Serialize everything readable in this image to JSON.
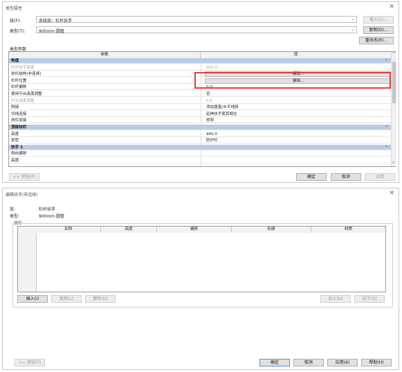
{
  "type_props": {
    "title": "类型属性",
    "family_label": "族(F):",
    "family_value": "系统族：栏杆扶手",
    "type_label": "类型(T):",
    "type_value": "900mm 圆管",
    "load_button": "载入(L)...",
    "duplicate_button": "复制(D)...",
    "rename_button": "重命名(R)...",
    "section_label": "类型参数",
    "col_param": "参数",
    "col_value": "值",
    "rows": [
      {
        "name": "构造",
        "value": "",
        "group": true
      },
      {
        "name": "栏杆扶手高度",
        "value": "900.0",
        "dim": true
      },
      {
        "name": "扶栏结构(非连续)",
        "value": "编辑...",
        "edit": true
      },
      {
        "name": "栏杆位置",
        "value": "编辑...",
        "edit": true
      },
      {
        "name": "栏杆偏移",
        "value": "0.0"
      },
      {
        "name": "使用平台高度调整",
        "value": "否"
      },
      {
        "name": "平台高度调整",
        "value": "0.0",
        "dim": true
      },
      {
        "name": "斜接",
        "value": "添加垂直/水平线段"
      },
      {
        "name": "切线连接",
        "value": "延伸扶手使其相交"
      },
      {
        "name": "扶栏连接",
        "value": "修剪"
      },
      {
        "name": "顶部扶栏",
        "value": "",
        "group": true
      },
      {
        "name": "高度",
        "value": "900.0"
      },
      {
        "name": "类型",
        "value": "防护栏"
      },
      {
        "name": "扶手 1",
        "value": "",
        "group": true
      },
      {
        "name": "侧向偏移",
        "value": ""
      },
      {
        "name": "高度",
        "value": ""
      }
    ],
    "preview_button": "<< 预览(P)",
    "ok_button": "确定",
    "cancel_button": "取消",
    "apply_button": "应用"
  },
  "rail_edit": {
    "title": "编辑扶手(非连续)",
    "family_label": "族:",
    "family_value": "栏杆扶手",
    "type_label": "类型:",
    "type_value": "900mm 圆管",
    "group_label": "扶栏",
    "columns": [
      "名称",
      "高度",
      "偏移",
      "轮廓",
      "材质"
    ],
    "insert_button": "插入(I)",
    "copy_button": "复制(L)",
    "delete_button": "删除(D)",
    "up_button": "向上(U)",
    "down_button": "向下(O)",
    "preview_button": "<< 预览(P)",
    "ok_button": "确定",
    "cancel_button": "取消",
    "apply_button": "应用(A)",
    "help_button": "帮助(H)"
  }
}
